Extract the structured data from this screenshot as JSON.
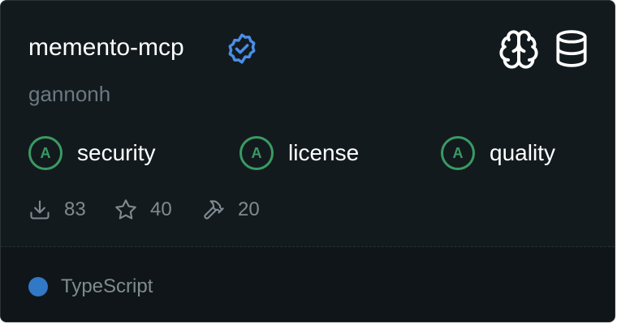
{
  "package": {
    "name": "memento-mcp",
    "author": "gannonh"
  },
  "header_icons": {
    "verified": "verified-badge-icon",
    "brain": "brain-icon",
    "database": "database-icon"
  },
  "scores": [
    {
      "grade": "A",
      "label": "security"
    },
    {
      "grade": "A",
      "label": "license"
    },
    {
      "grade": "A",
      "label": "quality"
    }
  ],
  "stats": {
    "downloads": "83",
    "stars": "40",
    "tools": "20"
  },
  "language": {
    "name": "TypeScript",
    "color": "#3178c6"
  },
  "colors": {
    "card_bg": "#131a1e",
    "footer_bg": "#0f1518",
    "grade_green": "#3a9a63",
    "verified_blue": "#4a8fe7",
    "muted_text": "#7f8b91"
  }
}
